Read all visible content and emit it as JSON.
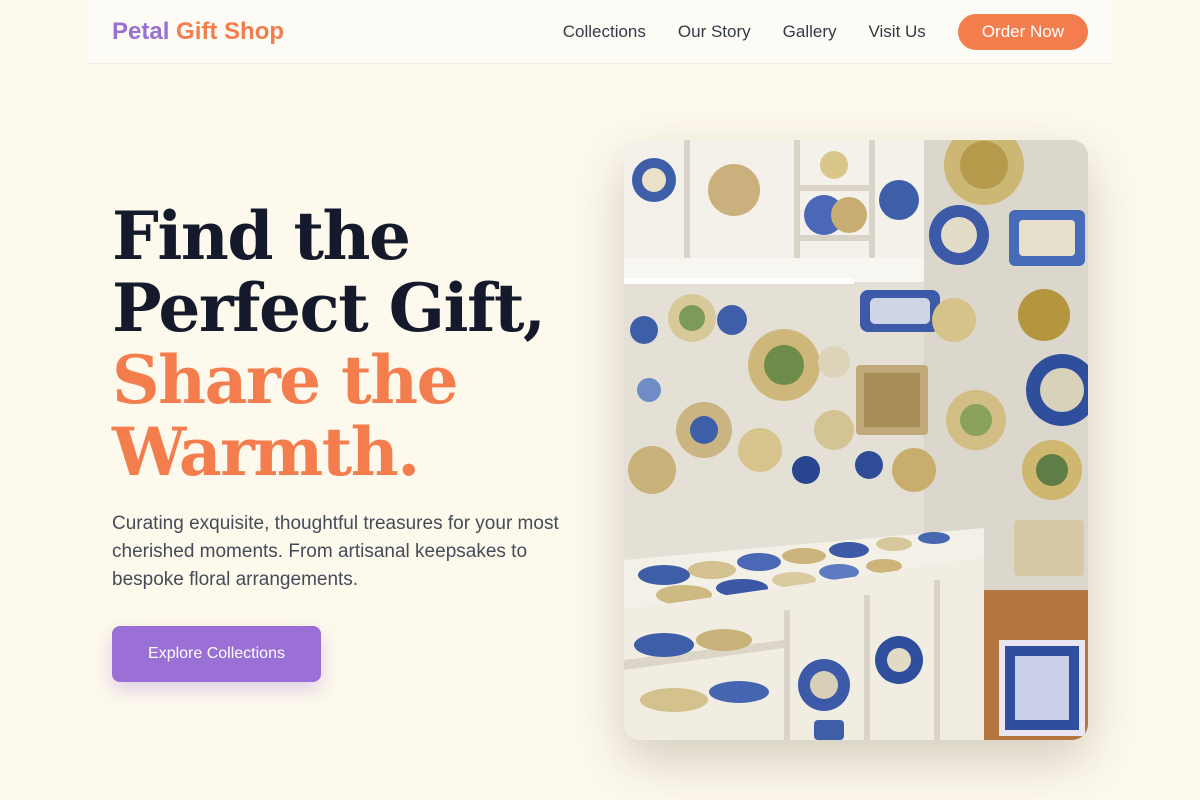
{
  "header": {
    "logo": {
      "word1": "Petal",
      "word2": "Gift Shop"
    },
    "nav": [
      {
        "label": "Collections"
      },
      {
        "label": "Our Story"
      },
      {
        "label": "Gallery"
      },
      {
        "label": "Visit Us"
      }
    ],
    "order_button": "Order Now"
  },
  "hero": {
    "title_line1": "Find the",
    "title_line2": "Perfect Gift,",
    "title_line3": "Share the",
    "title_line4": "Warmth.",
    "subtitle": "Curating exquisite, thoughtful treasures for your most cherished moments. From artisanal keepsakes to bespoke floral arrangements.",
    "cta_button": "Explore Collections",
    "image": "photo-of-ceramic-shop-shelves-with-painted-plates"
  },
  "colors": {
    "background": "#fdf9ec",
    "brand_purple": "#9a6fd6",
    "brand_orange": "#f47d4e",
    "heading_dark": "#141a2b",
    "body_text": "#454c58"
  }
}
